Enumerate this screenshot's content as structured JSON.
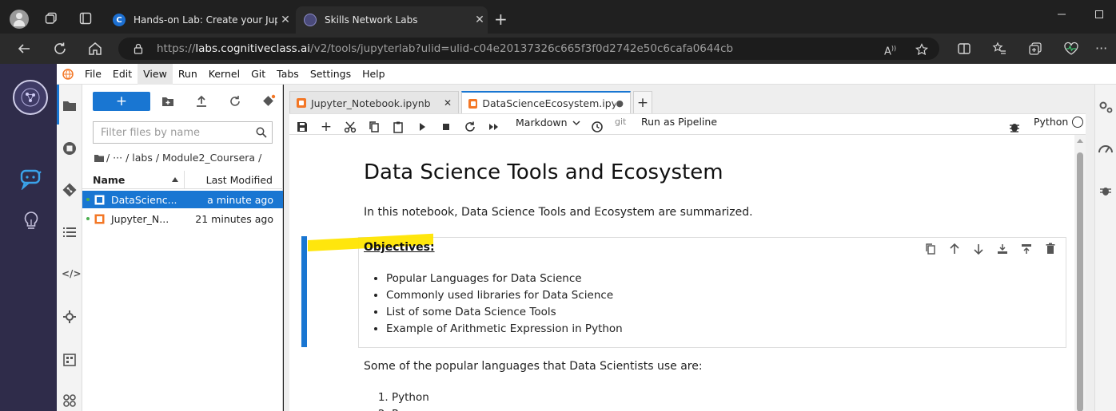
{
  "browser": {
    "tabs": [
      {
        "title": "Hands-on Lab: Create your Jupyt",
        "close": "✕"
      },
      {
        "title": "Skills Network Labs",
        "close": "✕"
      }
    ],
    "new_tab": "+",
    "url_host": "labs.cognitiveclass.ai",
    "url_rest": "/v2/tools/jupyterlab?ulid=ulid-c04e20137326c665f3f0d2742e50c6cafa0644cb",
    "url_scheme": "https://"
  },
  "menu": [
    "File",
    "Edit",
    "View",
    "Run",
    "Kernel",
    "Git",
    "Tabs",
    "Settings",
    "Help"
  ],
  "filebrowser": {
    "new_button": "+",
    "filter_placeholder": "Filter files by name",
    "breadcrumb": "/   ···   / labs / Module2_Coursera /",
    "col_name": "Name",
    "col_modified": "Last Modified",
    "files": [
      {
        "name": "DataScienc...",
        "modified": "a minute ago"
      },
      {
        "name": "Jupyter_N...",
        "modified": "21 minutes ago"
      }
    ]
  },
  "notebook": {
    "tabs": [
      {
        "title": "Jupyter_Notebook.ipynb",
        "close": "✕"
      },
      {
        "title": "DataScienceEcosystem.ipyn",
        "close": "●"
      }
    ],
    "add_tab": "+",
    "cell_type": "Markdown",
    "git_label": "git",
    "run_pipeline": "Run as Pipeline",
    "kernel": "Python",
    "heading": "Data Science Tools and Ecosystem",
    "intro": "In this notebook, Data Science Tools and Ecosystem are summarized.",
    "objectives_title": "Objectives:",
    "objectives": [
      "Popular Languages for Data Science",
      "Commonly used libraries for Data Science",
      "List of some Data Science Tools",
      "Example of Arithmetic Expression in Python"
    ],
    "languages_intro": "Some of the popular languages that Data Scientists use are:",
    "languages": [
      "Python",
      "R"
    ]
  },
  "colors": {
    "accent": "#1976d2",
    "highlight": "#ffe500",
    "activity_bg": "#2f2c4a",
    "jupyter_orange": "#f37726"
  }
}
